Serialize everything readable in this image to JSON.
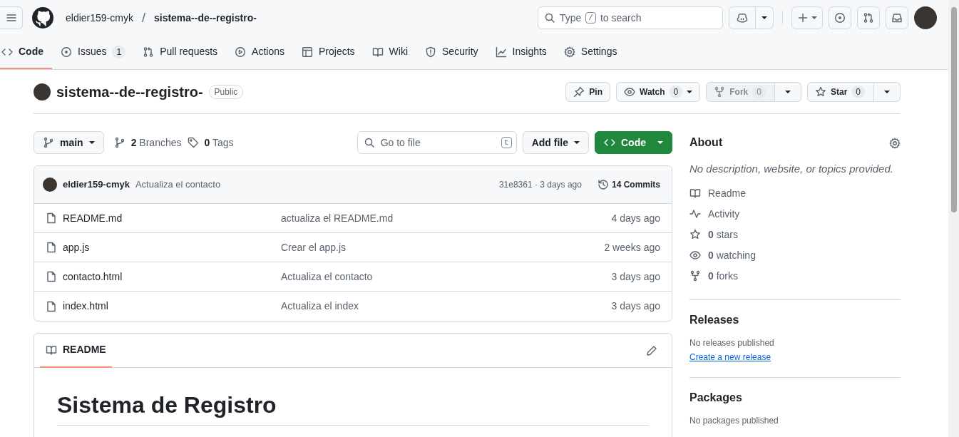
{
  "header": {
    "owner": "eldier159-cmyk",
    "separator": "/",
    "repo": "sistema--de--registro-",
    "search": {
      "before": "Type",
      "key": "/",
      "after": "to search"
    }
  },
  "tabs": [
    {
      "label": "Code",
      "selected": true
    },
    {
      "label": "Issues",
      "count": "1",
      "selected": false
    },
    {
      "label": "Pull requests",
      "selected": false
    },
    {
      "label": "Actions",
      "selected": false
    },
    {
      "label": "Projects",
      "selected": false
    },
    {
      "label": "Wiki",
      "selected": false
    },
    {
      "label": "Security",
      "selected": false
    },
    {
      "label": "Insights",
      "selected": false
    },
    {
      "label": "Settings",
      "selected": false
    }
  ],
  "repo": {
    "name": "sistema--de--registro-",
    "visibility": "Public",
    "actions": [
      {
        "label": "Pin",
        "disabled": false
      },
      {
        "label": "Watch",
        "count": "0",
        "disabled": false
      },
      {
        "label": "Fork",
        "count": "0",
        "disabled": true
      },
      {
        "label": "Star",
        "count": "0",
        "disabled": false
      }
    ]
  },
  "toolbar": {
    "branch": "main",
    "branches": "**2** Branches",
    "tags": "**0** Tags",
    "go_to_file": {
      "placeholder": "Go to file",
      "key": "t"
    },
    "add_file": "Add file",
    "code": "Code"
  },
  "commit": {
    "author": "eldier159-cmyk",
    "message": "Actualiza el contacto",
    "meta": "31e8361 · 3 days ago",
    "commits": "14 Commits"
  },
  "files": [
    {
      "name": "README.md",
      "message": "actualiza el README.md",
      "time": "4 days ago"
    },
    {
      "name": "app.js",
      "message": "Crear el app.js",
      "time": "2 weeks ago"
    },
    {
      "name": "contacto.html",
      "message": "Actualiza el contacto",
      "time": "3 days ago"
    },
    {
      "name": "index.html",
      "message": "Actualiza el index",
      "time": "3 days ago"
    }
  ],
  "readme": {
    "tab": "README",
    "heading": "Sistema de Registro"
  },
  "about": {
    "title": "About",
    "description": "No description, website, or topics provided.",
    "links": [
      "Readme",
      "Activity",
      "**0** stars",
      "**0** watching",
      "**0** forks"
    ]
  },
  "releases": {
    "title": "Releases",
    "text": "No releases published",
    "link": "Create a new release"
  },
  "packages": {
    "title": "Packages",
    "text": "No packages published"
  }
}
